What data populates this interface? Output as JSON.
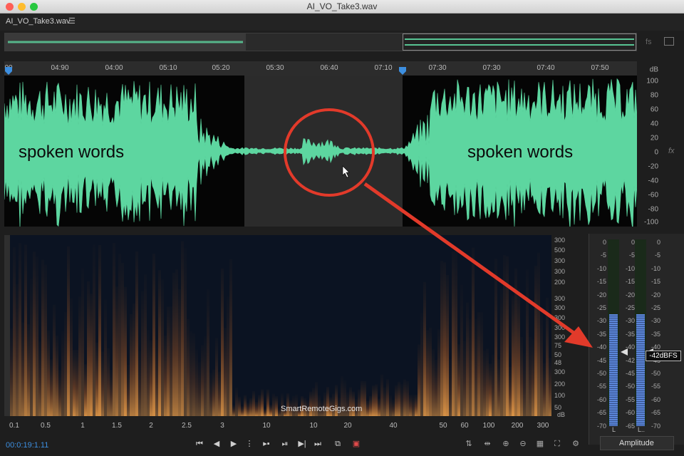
{
  "window": {
    "title": "AI_VO_Take3.wav"
  },
  "file_tab": {
    "label": "AI_VO_Take3.wav",
    "menu_icon": "hamburger-icon"
  },
  "overview": {
    "fs_label": "fs"
  },
  "ruler": {
    "labels": [
      "00",
      "04:90",
      "04:00",
      "05:10",
      "05:20",
      "05:30",
      "06:40",
      "07:10",
      "07:30",
      "07:30",
      "07:40",
      "07:50"
    ]
  },
  "db_axis": {
    "unit": "dB",
    "labels": [
      "100",
      "80",
      "60",
      "40",
      "20",
      "0",
      "-20",
      "-40",
      "-60",
      "-80",
      "-100"
    ]
  },
  "annotations": {
    "left_text": "spoken words",
    "right_text": "spoken words",
    "callout_color": "#e23a2a"
  },
  "fx_label": "fx",
  "spectral": {
    "hz_labels": [
      "300",
      "500",
      "300",
      "300",
      "200",
      "300",
      "300",
      "300",
      "300",
      "300",
      "75",
      "50",
      "48",
      "300",
      "200",
      "100",
      "50",
      "100"
    ],
    "hz_unit": "dB",
    "time_labels": [
      "0.1",
      "0.5",
      "1",
      "1.5",
      "2",
      "2.5",
      "3",
      "10",
      "10",
      "20",
      "40",
      "50",
      "60",
      "100",
      "200",
      "300"
    ],
    "watermark": "SmartRemoteGigs.com"
  },
  "meters": {
    "left_scale": [
      "0",
      "-5",
      "-10",
      "-15",
      "-20",
      "-25",
      "-30",
      "-35",
      "-40",
      "-45",
      "-50",
      "-55",
      "-60",
      "-65",
      "-70"
    ],
    "mid_scale": [
      "0",
      "-5",
      "-10",
      "-15",
      "-20",
      "-25",
      "-30",
      "-35",
      "-40",
      "-42",
      "-45",
      "-50",
      "-55",
      "-60",
      "-65"
    ],
    "right_scale": [
      "0",
      "-5",
      "-10",
      "-15",
      "-20",
      "-25",
      "-30",
      "-35",
      "-40",
      "-45",
      "-50",
      "-55",
      "-60",
      "-65",
      "-70"
    ],
    "channel_left": "L",
    "channel_right": "L..",
    "peak_tooltip": "-42dBFS",
    "level_dbfs": -42
  },
  "amplitude_select": {
    "value": "Amplitude"
  },
  "transport": {
    "timecode": "00:0:19:1.11"
  },
  "colors": {
    "waveform": "#5dd6a0",
    "accent_blue": "#3d8fe0",
    "spectral_warm": "#d8823a"
  }
}
